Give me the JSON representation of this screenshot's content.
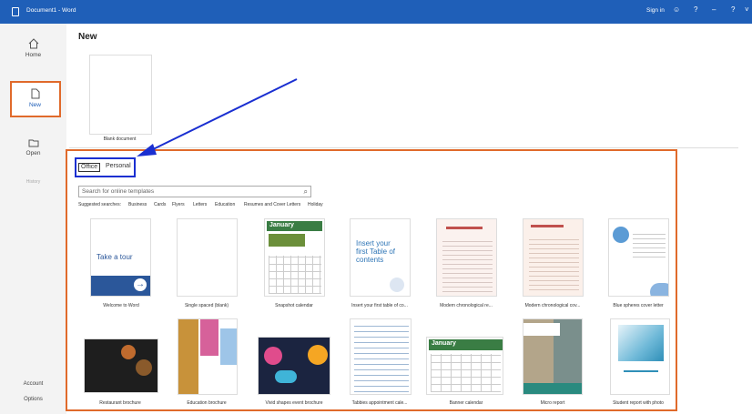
{
  "titlebar": {
    "title": "Document1 - Word",
    "sign_in": "Sign in"
  },
  "sidebar": {
    "home": "Home",
    "new": "New",
    "open": "Open",
    "history": "History",
    "account": "Account",
    "options": "Options"
  },
  "main": {
    "title": "New",
    "blank_label": "Blank document",
    "tabs": {
      "office": "Office",
      "personal": "Personal"
    },
    "search_placeholder": "Search for online templates",
    "suggested": [
      "Suggested searches:",
      "Business",
      "Cards",
      "Flyers",
      "Letters",
      "Education",
      "Resumes and Cover Letters",
      "Holiday"
    ]
  },
  "templates": {
    "row1": [
      {
        "label": "Welcome to Word",
        "text": "Take a tour"
      },
      {
        "label": "Single spaced (blank)"
      },
      {
        "label": "Snapshot calendar",
        "text": "January"
      },
      {
        "label": "Insert your first table of co...",
        "text": "Insert your first Table of contents"
      },
      {
        "label": "Modern chronological re..."
      },
      {
        "label": "Modern chronological cov..."
      },
      {
        "label": "Blue spheres cover letter"
      }
    ],
    "row2": [
      {
        "label": "Restaurant brochure"
      },
      {
        "label": "Education brochure"
      },
      {
        "label": "Vivid shapes event brochure"
      },
      {
        "label": "Tabbies appointment cale..."
      },
      {
        "label": "Banner calendar",
        "text": "January"
      },
      {
        "label": "Micro report"
      },
      {
        "label": "Student report with photo"
      }
    ]
  },
  "colors": {
    "titlebar": "#1f5fb8",
    "highlight_orange": "#e06a2b",
    "highlight_blue": "#1a2fd1"
  }
}
